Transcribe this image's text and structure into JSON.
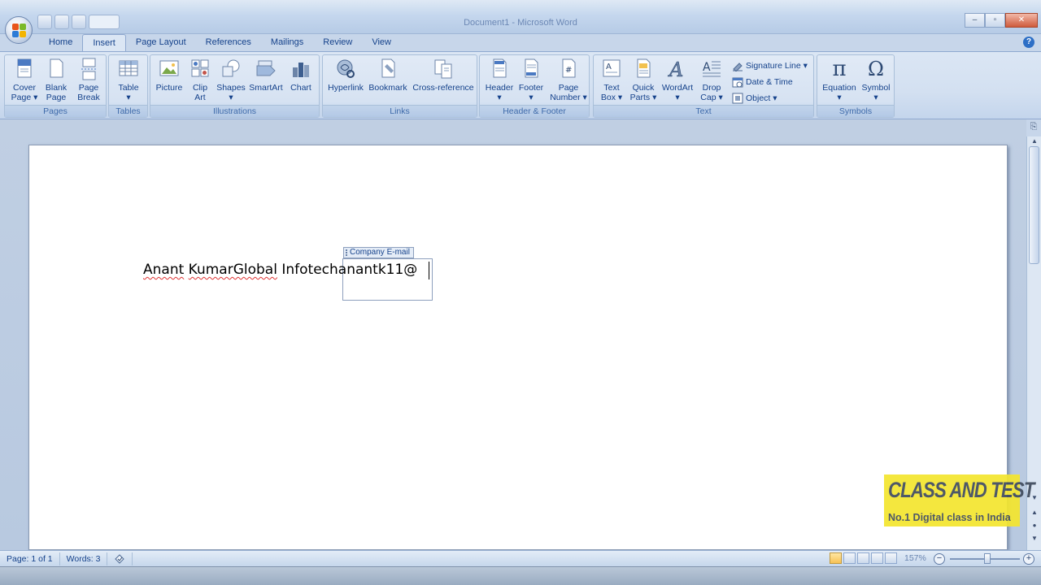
{
  "window": {
    "title": "Document1 - Microsoft Word"
  },
  "tabs": [
    "Home",
    "Insert",
    "Page Layout",
    "References",
    "Mailings",
    "Review",
    "View"
  ],
  "active_tab": "Insert",
  "ribbon": {
    "pages": {
      "label": "Pages",
      "cover": [
        "Cover",
        "Page ▾"
      ],
      "blank": [
        "Blank",
        "Page"
      ],
      "break": [
        "Page",
        "Break"
      ]
    },
    "tables": {
      "label": "Tables",
      "table": [
        "Table",
        "▾"
      ]
    },
    "illustrations": {
      "label": "Illustrations",
      "picture": "Picture",
      "clipart": [
        "Clip",
        "Art"
      ],
      "shapes": [
        "Shapes",
        "▾"
      ],
      "smartart": "SmartArt",
      "chart": "Chart"
    },
    "links": {
      "label": "Links",
      "hyperlink": "Hyperlink",
      "bookmark": "Bookmark",
      "crossref": "Cross-reference"
    },
    "header_footer": {
      "label": "Header & Footer",
      "header": [
        "Header",
        "▾"
      ],
      "footer": [
        "Footer",
        "▾"
      ],
      "page_number": [
        "Page",
        "Number ▾"
      ]
    },
    "text": {
      "label": "Text",
      "textbox": [
        "Text",
        "Box ▾"
      ],
      "quickparts": [
        "Quick",
        "Parts ▾"
      ],
      "wordart": [
        "WordArt",
        "▾"
      ],
      "dropcap": [
        "Drop",
        "Cap ▾"
      ],
      "signature": "Signature Line ▾",
      "datetime": "Date & Time",
      "object": "Object ▾"
    },
    "symbols": {
      "label": "Symbols",
      "equation": [
        "Equation",
        "▾"
      ],
      "symbol": [
        "Symbol",
        "▾"
      ]
    }
  },
  "document": {
    "text_name_1": "Anant",
    "text_name_2": "KumarGlobal",
    "text_rest": " Infotechanantk11@",
    "content_control_title": "Company E-mail"
  },
  "watermark": {
    "line1": "CLASS AND TEST",
    "line2": "No.1 Digital class in India"
  },
  "status": {
    "page": "Page: 1 of 1",
    "words": "Words: 3",
    "zoom": "157%"
  },
  "colors": {
    "accent": "#15428b",
    "ribbon_bg": "#dbe6f4",
    "watermark_bg": "#f4e62e"
  }
}
